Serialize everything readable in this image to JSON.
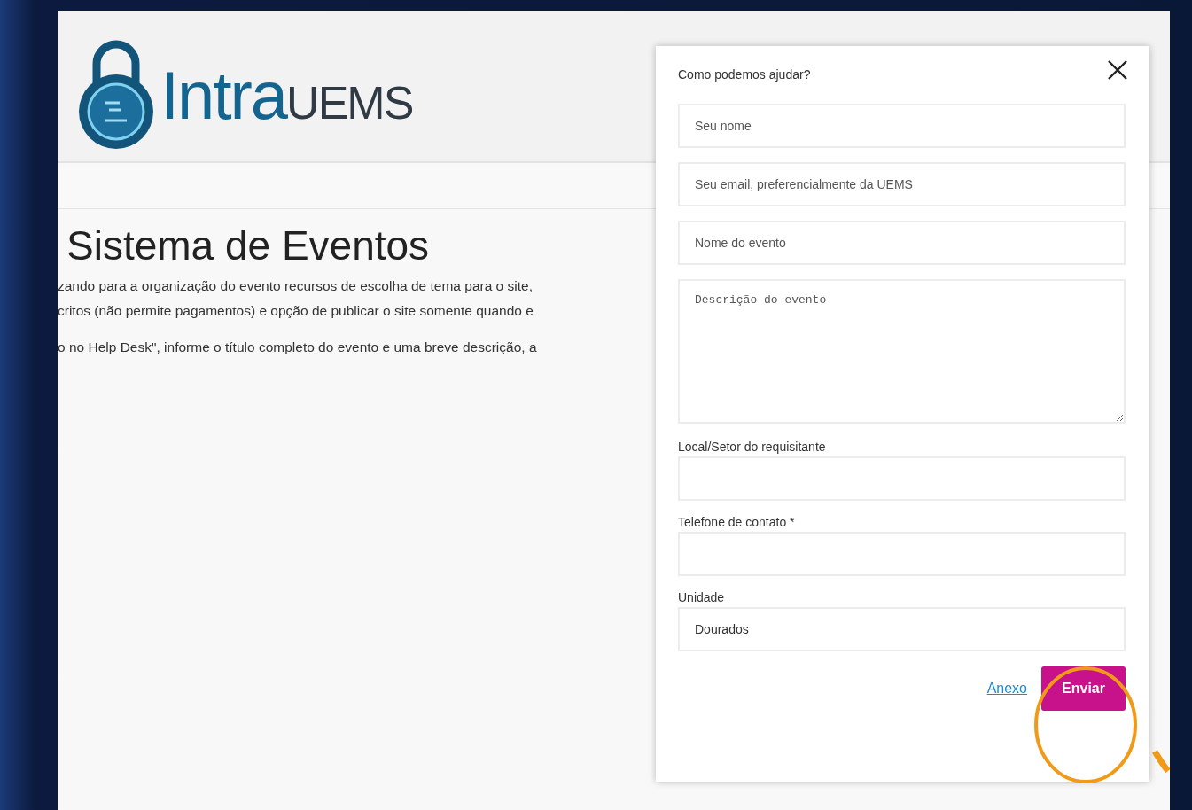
{
  "logo": {
    "brand_primary": "Intra",
    "brand_secondary": "UEMS"
  },
  "page": {
    "title": "Sistema de Eventos",
    "paragraphs": [
      "zando para a organização do evento recursos de escolha de tema para o site,",
      "critos (não permite pagamentos) e opção de publicar o site somente quando e",
      "o no Help Desk\", informe o título completo do evento e uma breve descrição, a"
    ]
  },
  "help_modal": {
    "title": "Como podemos ajudar?",
    "fields": [
      {
        "kind": "input",
        "placeholder": "Seu nome"
      },
      {
        "kind": "input",
        "placeholder": "Seu email, preferencialmente da UEMS"
      },
      {
        "kind": "input",
        "placeholder": "Nome do evento"
      },
      {
        "kind": "textarea",
        "placeholder": "Descrição do evento"
      },
      {
        "kind": "input",
        "label": "Local/Setor do requisitante"
      },
      {
        "kind": "input",
        "label": "Telefone de contato *"
      },
      {
        "kind": "input",
        "label": "Unidade",
        "value": "Dourados"
      }
    ],
    "attachment_link": "Anexo",
    "submit_button": "Enviar"
  }
}
